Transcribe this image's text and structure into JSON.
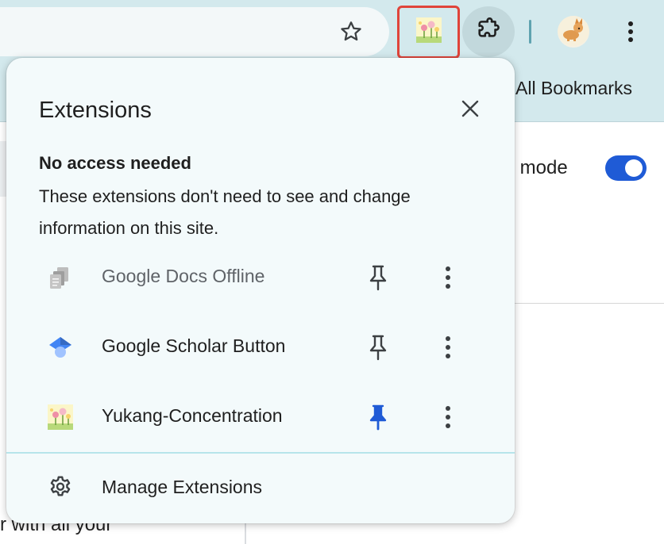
{
  "toolbar": {
    "star_icon": "bookmark-star-icon",
    "pinned_extension_icon": "yukang-concentration-icon",
    "extensions_button_icon": "puzzle-icon",
    "profile_icon": "corgi-avatar-icon",
    "menu_icon": "three-dot-menu-icon",
    "highlight_color": "#e0443a"
  },
  "bookmarks_bar": {
    "all_bookmarks_label": "All Bookmarks"
  },
  "background_page": {
    "reader_mode_text": "r mode",
    "reader_mode_enabled": true,
    "bottom_text": "r with all your",
    "toggle_color": "#1f5bd6"
  },
  "popup": {
    "title": "Extensions",
    "close_icon": "close-icon",
    "section_heading": "No access needed",
    "section_description": "These extensions don't need to see and change information on this site.",
    "extensions": [
      {
        "name": "Google Docs Offline",
        "icon": "google-docs-offline-icon",
        "pinned": false,
        "muted": true
      },
      {
        "name": "Google Scholar Button",
        "icon": "google-scholar-icon",
        "pinned": false,
        "muted": false
      },
      {
        "name": "Yukang-Concentration",
        "icon": "yukang-concentration-icon",
        "pinned": true,
        "muted": false
      }
    ],
    "pin_color_active": "#1f5bd6",
    "manage_label": "Manage Extensions",
    "manage_icon": "gear-icon"
  }
}
